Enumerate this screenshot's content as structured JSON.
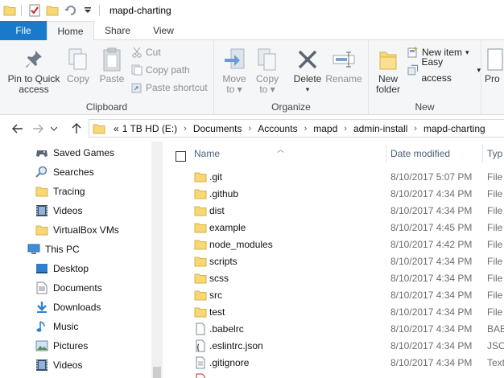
{
  "window": {
    "title": "mapd-charting"
  },
  "quick_access": {
    "items": [
      "folder-icon",
      "properties-check-icon",
      "new-folder-icon",
      "undo-icon",
      "customize-dropdown-icon"
    ]
  },
  "tabs": [
    {
      "label": "File"
    },
    {
      "label": "Home"
    },
    {
      "label": "Share"
    },
    {
      "label": "View"
    }
  ],
  "ribbon": {
    "clipboard": {
      "label": "Clipboard",
      "pin": "Pin to Quick access",
      "pin_line1": "Pin to Quick",
      "pin_line2": "access",
      "copy": "Copy",
      "paste": "Paste",
      "cut": "Cut",
      "copy_path": "Copy path",
      "paste_shortcut": "Paste shortcut"
    },
    "organize": {
      "label": "Organize",
      "move_to": "Move",
      "move_to_sub": "to",
      "copy_to": "Copy",
      "copy_to_sub": "to",
      "delete": "Delete",
      "rename": "Rename"
    },
    "new": {
      "label": "New",
      "new_folder_line1": "New",
      "new_folder_line2": "folder",
      "new_item": "New item",
      "easy_access": "Easy access"
    },
    "open": {
      "properties_partial": "Pro"
    }
  },
  "address": {
    "overflow": "«",
    "crumbs": [
      "1 TB HD (E:)",
      "Documents",
      "Accounts",
      "mapd",
      "admin-install",
      "mapd-charting"
    ]
  },
  "nav_pane": {
    "items": [
      {
        "label": "Saved Games",
        "icon": "saved-games-icon"
      },
      {
        "label": "Searches",
        "icon": "search-icon"
      },
      {
        "label": "Tracing",
        "icon": "folder-icon"
      },
      {
        "label": "Videos",
        "icon": "videos-icon"
      },
      {
        "label": "VirtualBox VMs",
        "icon": "folder-icon"
      },
      {
        "label": "This PC",
        "icon": "this-pc-icon"
      },
      {
        "label": "Desktop",
        "icon": "desktop-icon"
      },
      {
        "label": "Documents",
        "icon": "documents-icon"
      },
      {
        "label": "Downloads",
        "icon": "downloads-icon"
      },
      {
        "label": "Music",
        "icon": "music-icon"
      },
      {
        "label": "Pictures",
        "icon": "pictures-icon"
      },
      {
        "label": "Videos",
        "icon": "videos-icon"
      }
    ]
  },
  "file_list": {
    "columns": {
      "name": "Name",
      "date": "Date modified",
      "type": "Typ"
    },
    "rows": [
      {
        "name": ".git",
        "date": "8/10/2017 5:07 PM",
        "type": "File",
        "icon": "folder-icon"
      },
      {
        "name": ".github",
        "date": "8/10/2017 4:34 PM",
        "type": "File",
        "icon": "folder-icon"
      },
      {
        "name": "dist",
        "date": "8/10/2017 4:34 PM",
        "type": "File",
        "icon": "folder-icon"
      },
      {
        "name": "example",
        "date": "8/10/2017 4:45 PM",
        "type": "File",
        "icon": "folder-icon"
      },
      {
        "name": "node_modules",
        "date": "8/10/2017 4:42 PM",
        "type": "File",
        "icon": "folder-icon"
      },
      {
        "name": "scripts",
        "date": "8/10/2017 4:34 PM",
        "type": "File",
        "icon": "folder-icon"
      },
      {
        "name": "scss",
        "date": "8/10/2017 4:34 PM",
        "type": "File",
        "icon": "folder-icon"
      },
      {
        "name": "src",
        "date": "8/10/2017 4:34 PM",
        "type": "File",
        "icon": "folder-icon"
      },
      {
        "name": "test",
        "date": "8/10/2017 4:34 PM",
        "type": "File",
        "icon": "folder-icon"
      },
      {
        "name": ".babelrc",
        "date": "8/10/2017 4:34 PM",
        "type": "BAB",
        "icon": "file-icon"
      },
      {
        "name": ".eslintrc.json",
        "date": "8/10/2017 4:34 PM",
        "type": "JSO",
        "icon": "json-file-icon"
      },
      {
        "name": ".gitignore",
        "date": "8/10/2017 4:34 PM",
        "type": "Text",
        "icon": "text-file-icon"
      }
    ]
  },
  "colors": {
    "file_tab": "#1979ca",
    "folder": "#f8d775",
    "header_text": "#4c607a"
  }
}
